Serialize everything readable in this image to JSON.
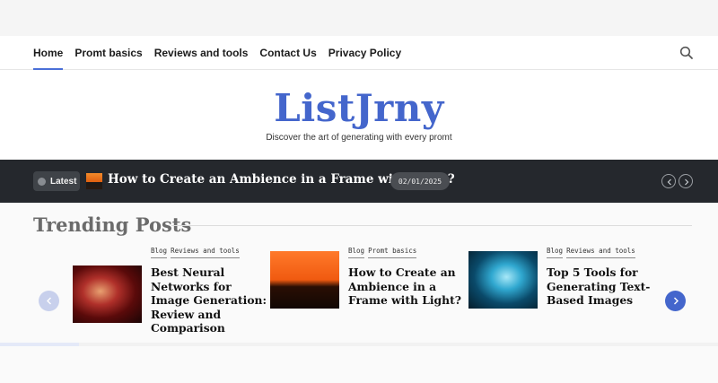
{
  "nav": {
    "items": [
      {
        "label": "Home",
        "active": true
      },
      {
        "label": "Promt basics",
        "active": false
      },
      {
        "label": "Reviews and tools",
        "active": false
      },
      {
        "label": "Contact Us",
        "active": false
      },
      {
        "label": "Privacy Policy",
        "active": false
      }
    ],
    "search_icon": "search-icon"
  },
  "site": {
    "title": "ListJrny",
    "tagline": "Discover the art of generating with every promt"
  },
  "ticker": {
    "badge": "Latest",
    "title": "How to Create an Ambience in a Frame with Light?",
    "date": "02/01/2025",
    "prev_icon": "chevron-left-icon",
    "next_icon": "chevron-right-icon"
  },
  "trending": {
    "heading": "Trending Posts",
    "cards": [
      {
        "tags": [
          "Blog",
          "Reviews and tools"
        ],
        "title": "Best Neural Networks for Image Generation: Review and Comparison"
      },
      {
        "tags": [
          "Blog",
          "Promt basics"
        ],
        "title": "How to Create an Ambience in a Frame with Light?"
      },
      {
        "tags": [
          "Blog",
          "Reviews and tools"
        ],
        "title": "Top 5 Tools for Generating Text-Based Images"
      }
    ],
    "carousel_progress": 0.11
  },
  "colors": {
    "accent": "#4466cc",
    "ticker_bg": "#25282d"
  }
}
